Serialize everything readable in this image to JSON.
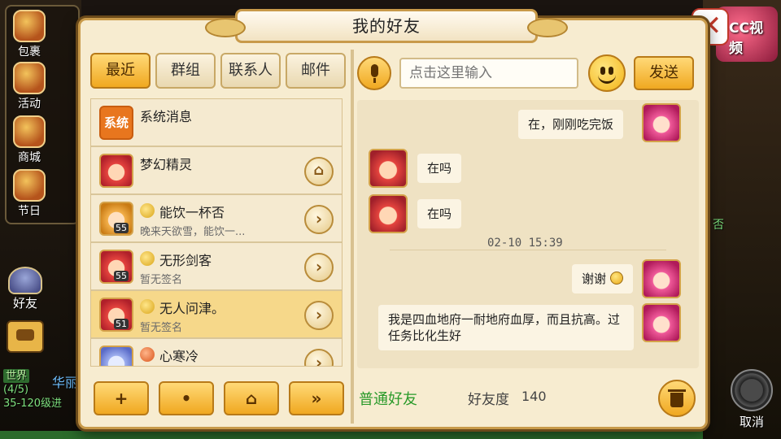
{
  "background": {
    "side_menu": [
      {
        "label": "包裹",
        "icon": "bag-icon"
      },
      {
        "label": "活动",
        "icon": "horn-icon"
      },
      {
        "label": "商城",
        "icon": "shop-icon"
      },
      {
        "label": "节日",
        "icon": "festival-icon"
      }
    ],
    "friend_button": "好友",
    "chat_log": {
      "world_tag": "世界",
      "line1_name": "华丽",
      "line2": "(4/5)",
      "line3": "35-120级进"
    },
    "right_text": "否",
    "cancel_button": "取消",
    "watermark": "CC视频"
  },
  "dialog": {
    "title": "我的好友",
    "tabs": [
      "最近",
      "群组",
      "联系人",
      "邮件"
    ],
    "active_tab": "最近",
    "friend_list": [
      {
        "name": "系统消息",
        "avatar": "系统",
        "signature": "",
        "level": "",
        "button": "",
        "selected": false
      },
      {
        "name": "梦幻精灵",
        "avatar": "face",
        "signature": "",
        "level": "",
        "button": "⌂",
        "selected": false
      },
      {
        "name": "能饮一杯否",
        "avatar": "face2",
        "signature": "晚来天欲雪，能饮一...",
        "level": "55",
        "button": "›",
        "selected": false
      },
      {
        "name": "无形剑客",
        "avatar": "face",
        "signature": "暂无签名",
        "level": "55",
        "button": "›",
        "selected": false
      },
      {
        "name": "无人问津。",
        "avatar": "face",
        "signature": "暂无签名",
        "level": "51",
        "button": "›",
        "selected": true
      },
      {
        "name": "心寒冷",
        "avatar": "face3",
        "signature": "",
        "level": "",
        "button": "›",
        "selected": false
      }
    ],
    "bottom_buttons": [
      {
        "name": "add-friend-button",
        "glyph": "+"
      },
      {
        "name": "chat-button",
        "glyph": "•"
      },
      {
        "name": "home-button",
        "glyph": "⌂"
      },
      {
        "name": "more-button",
        "glyph": "»"
      }
    ],
    "input": {
      "placeholder": "点击这里输入",
      "send_label": "发送"
    },
    "messages": [
      {
        "side": "right",
        "text": "在，刚刚吃完饭"
      },
      {
        "side": "left",
        "text": "在吗"
      },
      {
        "side": "left",
        "text": "在吗"
      },
      {
        "side": "right",
        "text": "谢谢"
      },
      {
        "side": "right",
        "text": "我是四血地府一耐地府血厚，而且抗高。过任务比化生好"
      }
    ],
    "timestamp": "02-10  15:39",
    "relation": "普通好友",
    "favor_label": "好友度",
    "favor_value": "140"
  },
  "colors": {
    "accent_gold": "#f0a820",
    "panel_bg": "#f7ecd0",
    "relation_green": "#2a9a2a"
  }
}
